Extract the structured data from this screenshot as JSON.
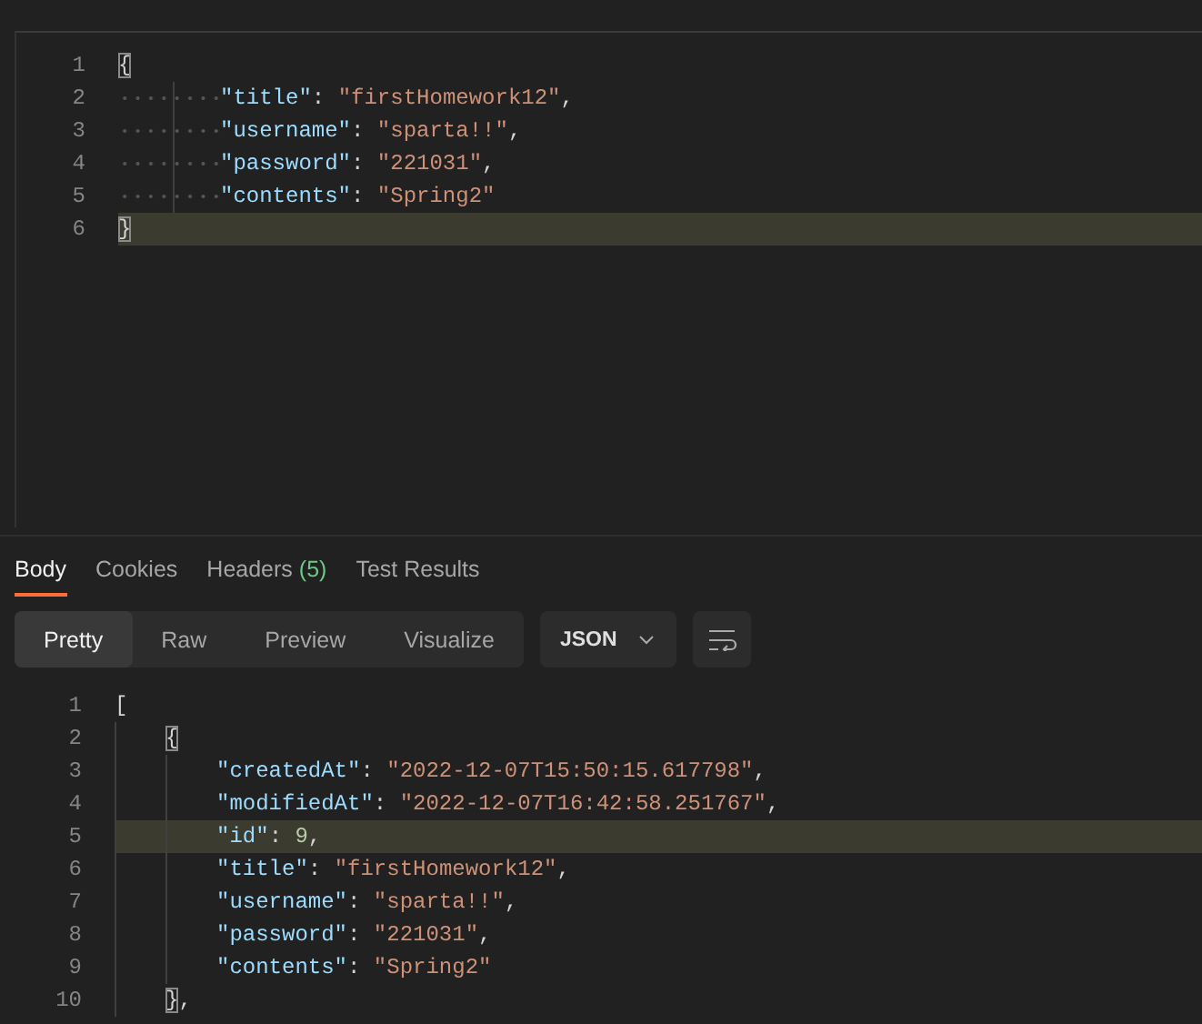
{
  "request_body": {
    "whitespace_visible": true,
    "lines": [
      {
        "number": "1",
        "selected": false,
        "tokens": [
          {
            "kind": "matched",
            "text": "{"
          }
        ],
        "children": [
          {
            "number": "2",
            "selected": false,
            "tokens": [
              {
                "kind": "key",
                "text": "\"title\""
              },
              {
                "kind": "punct",
                "text": ": "
              },
              {
                "kind": "string",
                "text": "\"firstHomework12\""
              },
              {
                "kind": "punct",
                "text": ","
              }
            ]
          },
          {
            "number": "3",
            "selected": false,
            "tokens": [
              {
                "kind": "key",
                "text": "\"username\""
              },
              {
                "kind": "punct",
                "text": ": "
              },
              {
                "kind": "string",
                "text": "\"sparta!!\""
              },
              {
                "kind": "punct",
                "text": ","
              }
            ]
          },
          {
            "number": "4",
            "selected": false,
            "tokens": [
              {
                "kind": "key",
                "text": "\"password\""
              },
              {
                "kind": "punct",
                "text": ": "
              },
              {
                "kind": "string",
                "text": "\"221031\""
              },
              {
                "kind": "punct",
                "text": ","
              }
            ]
          },
          {
            "number": "5",
            "selected": false,
            "tokens": [
              {
                "kind": "key",
                "text": "\"contents\""
              },
              {
                "kind": "punct",
                "text": ": "
              },
              {
                "kind": "string",
                "text": "\"Spring2\""
              }
            ]
          }
        ]
      },
      {
        "number": "6",
        "selected": true,
        "tokens": [
          {
            "kind": "matched",
            "text": "}"
          }
        ]
      }
    ]
  },
  "response_tabs": [
    {
      "label": "Body",
      "selected": true
    },
    {
      "label": "Cookies",
      "selected": false
    },
    {
      "label": "Headers",
      "count": "(5)",
      "selected": false
    },
    {
      "label": "Test Results",
      "selected": false
    }
  ],
  "view_modes": [
    {
      "label": "Pretty",
      "selected": true
    },
    {
      "label": "Raw",
      "selected": false
    },
    {
      "label": "Preview",
      "selected": false
    },
    {
      "label": "Visualize",
      "selected": false
    }
  ],
  "format_dropdown": {
    "value": "JSON"
  },
  "response_body": {
    "whitespace_visible": false,
    "lines": [
      {
        "number": "1",
        "selected": false,
        "tokens": [
          {
            "kind": "punct",
            "text": "["
          }
        ],
        "children": [
          {
            "number": "2",
            "selected": false,
            "tokens": [
              {
                "kind": "matched",
                "text": "{"
              }
            ],
            "children": [
              {
                "number": "3",
                "selected": false,
                "tokens": [
                  {
                    "kind": "key",
                    "text": "\"createdAt\""
                  },
                  {
                    "kind": "punct",
                    "text": ": "
                  },
                  {
                    "kind": "string",
                    "text": "\"2022-12-07T15:50:15.617798\""
                  },
                  {
                    "kind": "punct",
                    "text": ","
                  }
                ]
              },
              {
                "number": "4",
                "selected": false,
                "tokens": [
                  {
                    "kind": "key",
                    "text": "\"modifiedAt\""
                  },
                  {
                    "kind": "punct",
                    "text": ": "
                  },
                  {
                    "kind": "string",
                    "text": "\"2022-12-07T16:42:58.251767\""
                  },
                  {
                    "kind": "punct",
                    "text": ","
                  }
                ]
              },
              {
                "number": "5",
                "selected": true,
                "tokens": [
                  {
                    "kind": "key",
                    "text": "\"id\""
                  },
                  {
                    "kind": "punct",
                    "text": ": "
                  },
                  {
                    "kind": "number",
                    "text": "9"
                  },
                  {
                    "kind": "punct",
                    "text": ","
                  }
                ]
              },
              {
                "number": "6",
                "selected": false,
                "tokens": [
                  {
                    "kind": "key",
                    "text": "\"title\""
                  },
                  {
                    "kind": "punct",
                    "text": ": "
                  },
                  {
                    "kind": "string",
                    "text": "\"firstHomework12\""
                  },
                  {
                    "kind": "punct",
                    "text": ","
                  }
                ]
              },
              {
                "number": "7",
                "selected": false,
                "tokens": [
                  {
                    "kind": "key",
                    "text": "\"username\""
                  },
                  {
                    "kind": "punct",
                    "text": ": "
                  },
                  {
                    "kind": "string",
                    "text": "\"sparta!!\""
                  },
                  {
                    "kind": "punct",
                    "text": ","
                  }
                ]
              },
              {
                "number": "8",
                "selected": false,
                "tokens": [
                  {
                    "kind": "key",
                    "text": "\"password\""
                  },
                  {
                    "kind": "punct",
                    "text": ": "
                  },
                  {
                    "kind": "string",
                    "text": "\"221031\""
                  },
                  {
                    "kind": "punct",
                    "text": ","
                  }
                ]
              },
              {
                "number": "9",
                "selected": false,
                "tokens": [
                  {
                    "kind": "key",
                    "text": "\"contents\""
                  },
                  {
                    "kind": "punct",
                    "text": ": "
                  },
                  {
                    "kind": "string",
                    "text": "\"Spring2\""
                  }
                ]
              }
            ]
          },
          {
            "number": "10",
            "selected": false,
            "tokens": [
              {
                "kind": "matched",
                "text": "}"
              },
              {
                "kind": "punct",
                "text": ","
              }
            ]
          }
        ]
      }
    ]
  }
}
